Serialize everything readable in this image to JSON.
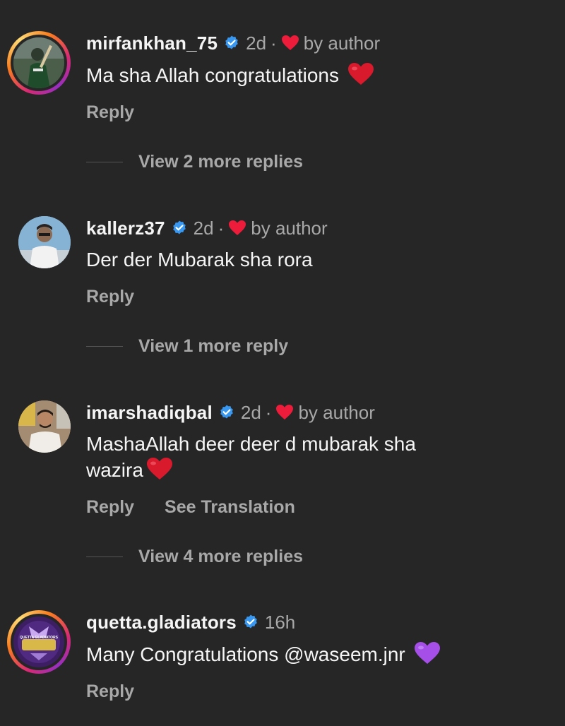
{
  "colors": {
    "background": "#262626",
    "primary_text": "#f5f5f5",
    "secondary_text": "#a8a8a8",
    "verified_blue": "#3897f0",
    "heart_red": "#ed1c3a",
    "purple_heart": "#a64ee8"
  },
  "comments": [
    {
      "username": "mirfankhan_75",
      "verified": true,
      "time": "2d",
      "separator": "·",
      "liked_by_author": "by author",
      "text": "Ma sha Allah congratulations",
      "emoji": "red-heart",
      "actions": {
        "reply": "Reply"
      },
      "more_replies": "View 2 more replies",
      "avatar_icon": "cricketer-avatar",
      "has_story_ring": true
    },
    {
      "username": "kallerz37",
      "verified": true,
      "time": "2d",
      "separator": "·",
      "liked_by_author": "by author",
      "text": "Der der Mubarak sha rora",
      "actions": {
        "reply": "Reply"
      },
      "more_replies": "View 1 more reply",
      "avatar_icon": "person-avatar",
      "has_story_ring": false
    },
    {
      "username": "imarshadiqbal",
      "verified": true,
      "time": "2d",
      "separator": "·",
      "liked_by_author": "by author",
      "text_line1": "MashaAllah deer deer d mubarak sha",
      "text_line2": "wazira",
      "emoji": "red-heart",
      "actions": {
        "reply": "Reply",
        "translate": "See Translation"
      },
      "more_replies": "View 4 more replies",
      "avatar_icon": "person-avatar",
      "has_story_ring": false
    },
    {
      "username": "quetta.gladiators",
      "verified": true,
      "time": "16h",
      "text": "Many Congratulations @waseem.jnr",
      "emoji": "purple-heart",
      "actions": {
        "reply": "Reply"
      },
      "avatar_icon": "gladiators-logo-avatar",
      "logo_text": "QUETTA GLADIATORS",
      "has_story_ring": true
    }
  ]
}
